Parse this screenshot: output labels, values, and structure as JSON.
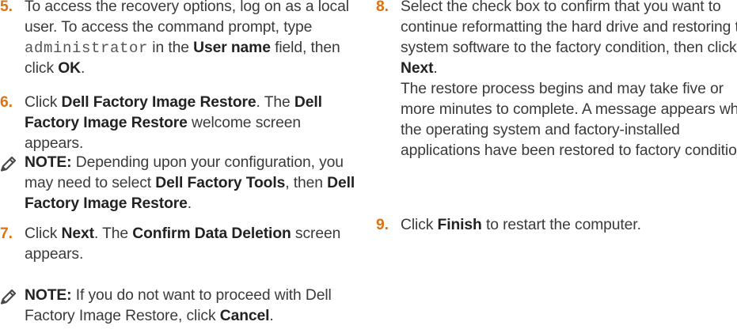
{
  "left": {
    "step5": {
      "num": "5.",
      "t1": "To access the recovery options, log on as a local user. To access the command prompt, type ",
      "code": "administrator",
      "t2": " in the ",
      "b1": "User name",
      "t3": " field, then click ",
      "b2": "OK",
      "t4": "."
    },
    "step6": {
      "num": "6.",
      "t1": "Click ",
      "b1": "Dell Factory Image Restore",
      "t2": ". The ",
      "b2": "Dell Factory Image Restore",
      "t3": " welcome screen appears."
    },
    "note1": {
      "label": "NOTE:",
      "t1": " Depending upon your configuration, you may need to select ",
      "b1": "Dell Factory Tools",
      "t2": ", then ",
      "b2": "Dell Factory Image Restore",
      "t3": "."
    },
    "step7": {
      "num": "7.",
      "t1": "Click ",
      "b1": "Next",
      "t2": ". The ",
      "b2": "Confirm Data Deletion",
      "t3": " screen appears."
    },
    "note2": {
      "label": "NOTE:",
      "t1": " If you do not want to proceed with Dell Factory Image Restore, click ",
      "b1": "Cancel",
      "t2": "."
    }
  },
  "right": {
    "step8": {
      "num": "8.",
      "t1": "Select the check box to confirm that you want to continue reformatting the hard drive and restoring the system software to the factory condition, then click ",
      "b1": "Next",
      "t2": ".",
      "t3": "The restore process begins and may take five or more minutes to complete. A message appears when the operating system and factory-installed applications have been restored to factory condition."
    },
    "step9": {
      "num": "9.",
      "t1": "Click ",
      "b1": "Finish",
      "t2": " to restart the computer."
    }
  },
  "colors": {
    "step_number": "#e0710f",
    "body_text": "#3a3a3a",
    "bold_text": "#222222",
    "note_icon": "#4a4a4a"
  },
  "icons": {
    "note": "pencil-icon"
  }
}
